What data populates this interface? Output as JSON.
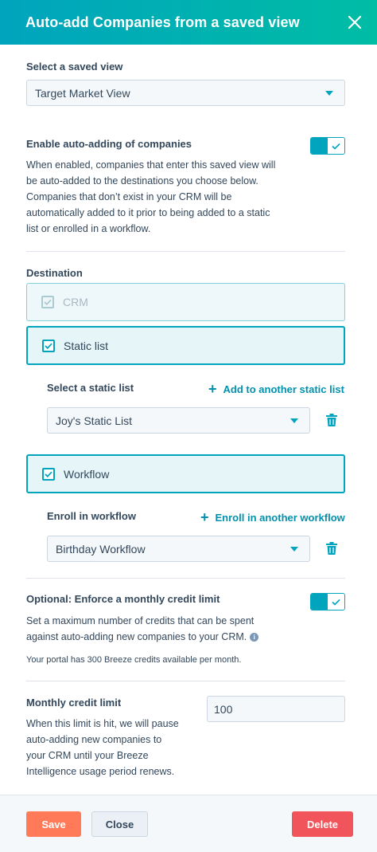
{
  "header": {
    "title": "Auto-add Companies from a saved view"
  },
  "saved_view": {
    "label": "Select a saved view",
    "value": "Target Market View"
  },
  "auto_add": {
    "label": "Enable auto-adding of companies",
    "enabled": true,
    "help": "When enabled, companies that enter this saved view will be auto-added to the destinations you choose below. Companies that don’t exist in your CRM will be automatically added to it prior to being added to a static list or enrolled in a workflow."
  },
  "destination": {
    "label": "Destination",
    "crm": {
      "label": "CRM",
      "checked": true,
      "disabled": true
    },
    "static_list": {
      "label": "Static list",
      "checked": true,
      "select_label": "Select a static list",
      "add_link": "Add to another static list",
      "value": "Joy's Static List"
    },
    "workflow": {
      "label": "Workflow",
      "checked": true,
      "select_label": "Enroll in workflow",
      "add_link": "Enroll in another workflow",
      "value": "Birthday Workflow"
    }
  },
  "credit_limit": {
    "label": "Optional: Enforce a monthly credit limit",
    "enabled": true,
    "help": "Set a maximum number of credits that can be spent against auto-adding new companies to your CRM.",
    "note": "Your portal has 300 Breeze credits available per month."
  },
  "monthly_limit": {
    "label": "Monthly credit limit",
    "value": "100",
    "help": "When this limit is hit, we will pause auto-adding new companies to your CRM until your Breeze Intelligence usage period renews."
  },
  "footer": {
    "save": "Save",
    "close": "Close",
    "delete": "Delete"
  },
  "colors": {
    "accent": "#00a4bd",
    "save": "#ff7a59",
    "delete": "#f2545b",
    "link": "#0091ae"
  }
}
